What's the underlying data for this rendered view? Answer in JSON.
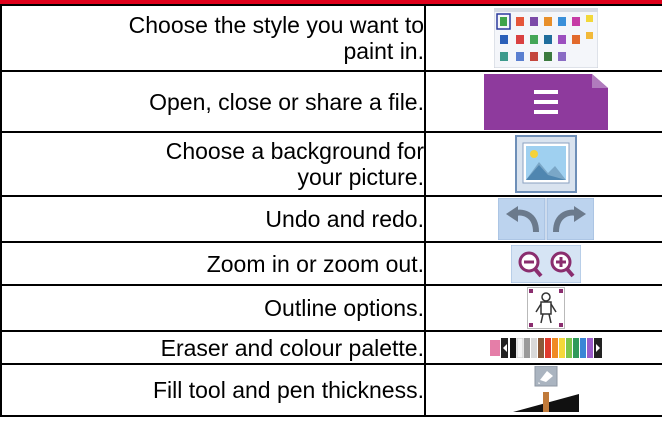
{
  "rows": [
    {
      "text": "Choose the style you want to\npaint in.",
      "icon": "style-gallery-icon"
    },
    {
      "text": "Open, close or share a file.",
      "icon": "file-menu-icon"
    },
    {
      "text": "Choose a background for\nyour picture.",
      "icon": "background-picture-icon"
    },
    {
      "text": "Undo and redo.",
      "icon": "undo-redo-icon"
    },
    {
      "text": "Zoom in or zoom out.",
      "icon": "zoom-icon"
    },
    {
      "text": "Outline options.",
      "icon": "outline-figure-icon"
    },
    {
      "text": "Eraser and colour palette.",
      "icon": "eraser-palette-icon"
    },
    {
      "text": "Fill tool and pen thickness.",
      "icon": "fill-pen-thickness-icon"
    }
  ],
  "colors": {
    "header_red": "#e0001b",
    "file_purple": "#8e3a9d",
    "tool_blue": "#bcd3ee"
  }
}
